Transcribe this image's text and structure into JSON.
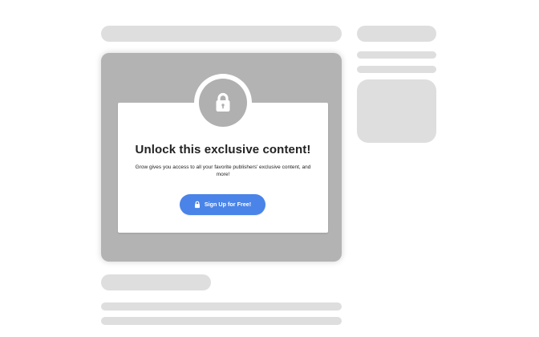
{
  "paywall": {
    "title": "Unlock this exclusive content!",
    "description": "Grow gives you access to all your favorite publishers' exclusive content, and more!",
    "cta_label": "Sign Up for Free!",
    "lock_icon": "lock-icon",
    "cta_icon": "lock-icon"
  },
  "theme": {
    "skeleton": "#dedede",
    "overlay": "#b3b3b3",
    "button": "#4a84e8",
    "text": "#222222"
  }
}
